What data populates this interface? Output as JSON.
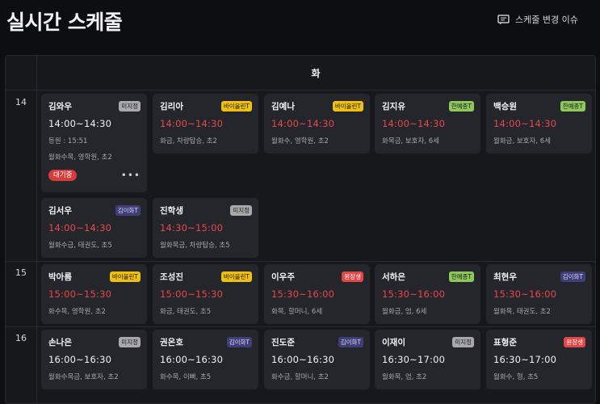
{
  "page": {
    "title": "실시간 스케줄"
  },
  "header": {
    "issue_button_label": "스케줄 변경 이슈",
    "issue_icon": "message-square-icon"
  },
  "schedule": {
    "day_label": "화",
    "hours": [
      "14",
      "15",
      "16"
    ]
  },
  "cards": [
    {
      "name": "김와우",
      "badge": "미지정",
      "badge_color": "gray",
      "time": "14:00~14:30",
      "time_color": "white",
      "arrival": "등원 : 15:51",
      "meta": "월화수목, 영학원, 초2",
      "status": "대기중",
      "more": "•••"
    },
    {
      "name": "김리아",
      "badge": "바이올린T",
      "badge_color": "yellow",
      "time": "14:00~14:30",
      "time_color": "red",
      "meta": "화금, 차량탑승, 초2"
    },
    {
      "name": "김예나",
      "badge": "바이올린T",
      "badge_color": "yellow",
      "time": "14:00~14:30",
      "time_color": "red",
      "meta": "월화수, 영학원, 초2"
    },
    {
      "name": "김지유",
      "badge": "한예종T",
      "badge_color": "green",
      "time": "14:00~14:30",
      "time_color": "red",
      "meta": "화목금, 보호자, 6세"
    },
    {
      "name": "백승원",
      "badge": "한예종T",
      "badge_color": "green",
      "time": "14:00~14:30",
      "time_color": "red",
      "meta": "월화금, 보호자, 6세"
    },
    {
      "name": "김서우",
      "badge": "김이화T",
      "badge_color": "purple",
      "time": "14:00~14:30",
      "time_color": "red",
      "meta": "월화수금, 태권도, 초5"
    },
    {
      "name": "진학생",
      "badge": "미지정",
      "badge_color": "gray",
      "time": "14:30~15:00",
      "time_color": "red",
      "meta": "월화목금, 차량탑승, 초5"
    },
    {
      "name": "박아름",
      "badge": "바이올린T",
      "badge_color": "yellow",
      "time": "15:00~15:30",
      "time_color": "red",
      "meta": "화수목, 영학원, 초2"
    },
    {
      "name": "조성진",
      "badge": "바이올린T",
      "badge_color": "yellow",
      "time": "15:00~15:30",
      "time_color": "red",
      "meta": "화금, 태권도, 초5"
    },
    {
      "name": "이우주",
      "badge": "원장생",
      "badge_color": "red",
      "time": "15:30~16:00",
      "time_color": "red",
      "meta": "화목, 할머니, 6세"
    },
    {
      "name": "서하은",
      "badge": "한예종T",
      "badge_color": "green",
      "time": "15:30~16:00",
      "time_color": "red",
      "meta": "월화금, 엄, 6세"
    },
    {
      "name": "최현우",
      "badge": "김이화T",
      "badge_color": "purple",
      "time": "15:30~16:00",
      "time_color": "red",
      "meta": "월화목, 태권도, 초2"
    },
    {
      "name": "손나은",
      "badge": "미지정",
      "badge_color": "gray",
      "time": "16:00~16:30",
      "time_color": "white",
      "meta": "월화수목금, 보호자, 초2"
    },
    {
      "name": "권온호",
      "badge": "김이화T",
      "badge_color": "purple",
      "time": "16:00~16:30",
      "time_color": "white",
      "meta": "화수목, 이뻐, 초5"
    },
    {
      "name": "진도준",
      "badge": "김이화T",
      "badge_color": "purple",
      "time": "16:00~16:30",
      "time_color": "white",
      "meta": "화수금, 할머니, 초2"
    },
    {
      "name": "이재이",
      "badge": "미지정",
      "badge_color": "gray",
      "time": "16:30~17:00",
      "time_color": "white",
      "meta": "월화목, 엄, 초2"
    },
    {
      "name": "표형준",
      "badge": "원장생",
      "badge_color": "red",
      "time": "16:30~17:00",
      "time_color": "white",
      "meta": "월화수, 형, 초5"
    }
  ]
}
